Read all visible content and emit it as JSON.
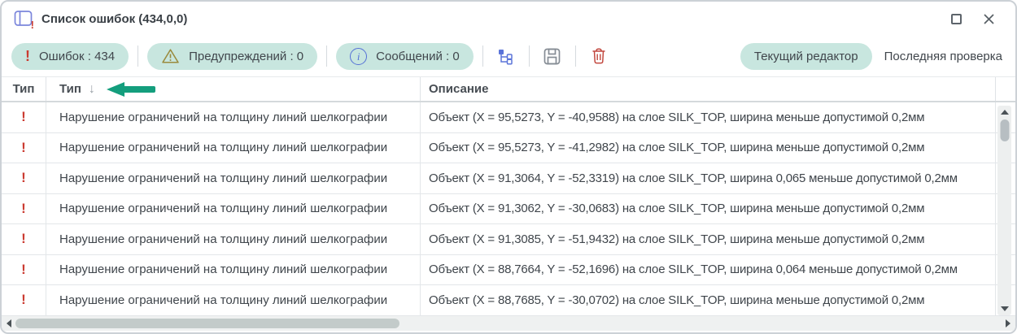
{
  "window": {
    "title": "Список ошибок (434,0,0)"
  },
  "toolbar": {
    "badges": [
      {
        "icon": "error-exclamation-icon",
        "label": "Ошибок : 434"
      },
      {
        "icon": "warning-triangle-icon",
        "label": "Предупреждений : 0"
      },
      {
        "icon": "info-circle-icon",
        "label": "Сообщений : 0"
      }
    ],
    "icons": [
      "tree-structure-icon",
      "save-icon",
      "trash-icon"
    ],
    "source_toggle": {
      "selected": "Текущий редактор",
      "other": "Последняя проверка"
    }
  },
  "table": {
    "columns": [
      {
        "label": "Тип"
      },
      {
        "label": "Тип",
        "sort": "↓"
      },
      {
        "label": "Описание"
      }
    ],
    "rows": [
      {
        "type_icon": "!",
        "type": "Нарушение ограничений на толщину линий шелкографии",
        "description": "Объект (X = 95,5273, Y = -40,9588) на слое SILK_TOP, ширина меньше допустимой 0,2мм"
      },
      {
        "type_icon": "!",
        "type": "Нарушение ограничений на толщину линий шелкографии",
        "description": "Объект (X = 95,5273, Y = -41,2982) на слое SILK_TOP, ширина меньше допустимой 0,2мм"
      },
      {
        "type_icon": "!",
        "type": "Нарушение ограничений на толщину линий шелкографии",
        "description": "Объект (X = 91,3064, Y = -52,3319) на слое SILK_TOP, ширина 0,065 меньше допустимой 0,2мм"
      },
      {
        "type_icon": "!",
        "type": "Нарушение ограничений на толщину линий шелкографии",
        "description": "Объект (X = 91,3062, Y = -30,0683) на слое SILK_TOP, ширина меньше допустимой 0,2мм"
      },
      {
        "type_icon": "!",
        "type": "Нарушение ограничений на толщину линий шелкографии",
        "description": "Объект (X = 91,3085, Y = -51,9432) на слое SILK_TOP, ширина меньше допустимой 0,2мм"
      },
      {
        "type_icon": "!",
        "type": "Нарушение ограничений на толщину линий шелкографии",
        "description": "Объект (X = 88,7664, Y = -52,1696) на слое SILK_TOP, ширина 0,064 меньше допустимой 0,2мм"
      },
      {
        "type_icon": "!",
        "type": "Нарушение ограничений на толщину линий шелкографии",
        "description": "Объект (X = 88,7685, Y = -30,0702) на слое SILK_TOP, ширина меньше допустимой 0,2мм"
      }
    ]
  },
  "colors": {
    "accent_teal": "#c8e6df",
    "error_red": "#cb3b31",
    "warning_olive": "#9a8b3e",
    "info_blue": "#5470d6",
    "annotation_green": "#149e7d"
  }
}
